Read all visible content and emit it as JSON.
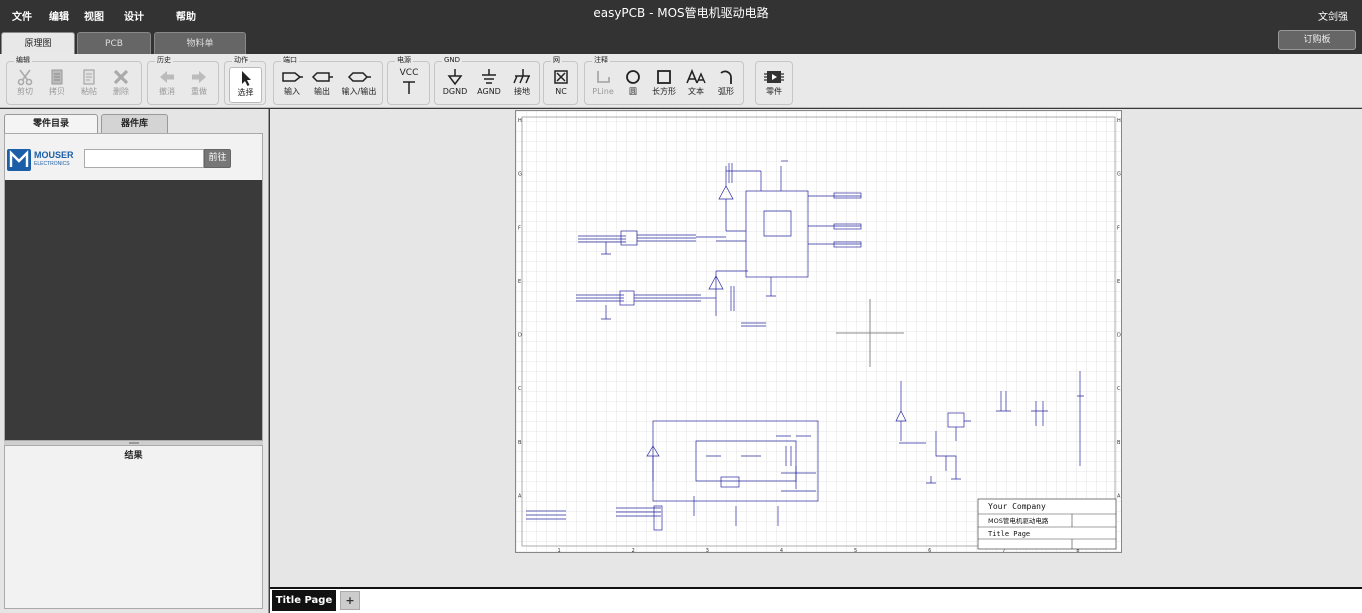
{
  "menu": {
    "file": "文件",
    "edit": "编辑",
    "view": "视图",
    "design": "设计",
    "help": "帮助"
  },
  "app": {
    "title": "easyPCB - MOS管电机驱动电路",
    "user": "文剑强"
  },
  "tabs": {
    "schematic": "原理图",
    "pcb": "PCB",
    "bom": "物料单",
    "order": "订购板"
  },
  "toolbar": {
    "groups": {
      "edit": "编辑",
      "history": "历史",
      "action": "动作",
      "port": "端口",
      "power": "电源",
      "gnd": "GND",
      "net": "网",
      "annotation": "注释"
    },
    "cut": "剪切",
    "copy": "拷贝",
    "paste": "粘帖",
    "delete": "删除",
    "undo": "撤消",
    "redo": "重做",
    "select": "选择",
    "input": "输入",
    "output": "输出",
    "inout": "输入/输出",
    "vcc": "VCC",
    "dgnd": "DGND",
    "agnd": "AGND",
    "earth": "接地",
    "nc": "NC",
    "pline": "PLine",
    "circle": "圆",
    "rect": "长方形",
    "text": "文本",
    "arc": "弧形",
    "part": "零件"
  },
  "left_panel": {
    "tab_catalog": "零件目录",
    "tab_library": "器件库",
    "mouser_line1": "MOUSER",
    "mouser_line2": "ELECTRONICS",
    "search_value": "",
    "go": "前往",
    "results_title": "结果"
  },
  "schematic": {
    "company": "Your Company",
    "project_name": "MOS管电机驱动电路",
    "page_title": "Title Page",
    "col_labels": [
      "1",
      "2",
      "3",
      "4",
      "5",
      "6",
      "7",
      "8"
    ],
    "row_labels": [
      "H",
      "G",
      "F",
      "E",
      "D",
      "C",
      "B",
      "A"
    ]
  },
  "bottom": {
    "page_tab": "Title Page",
    "add_page": "+"
  },
  "colors": {
    "topbar": "#333333",
    "wire": "#2828a0",
    "grid": "#dcdcdc"
  }
}
